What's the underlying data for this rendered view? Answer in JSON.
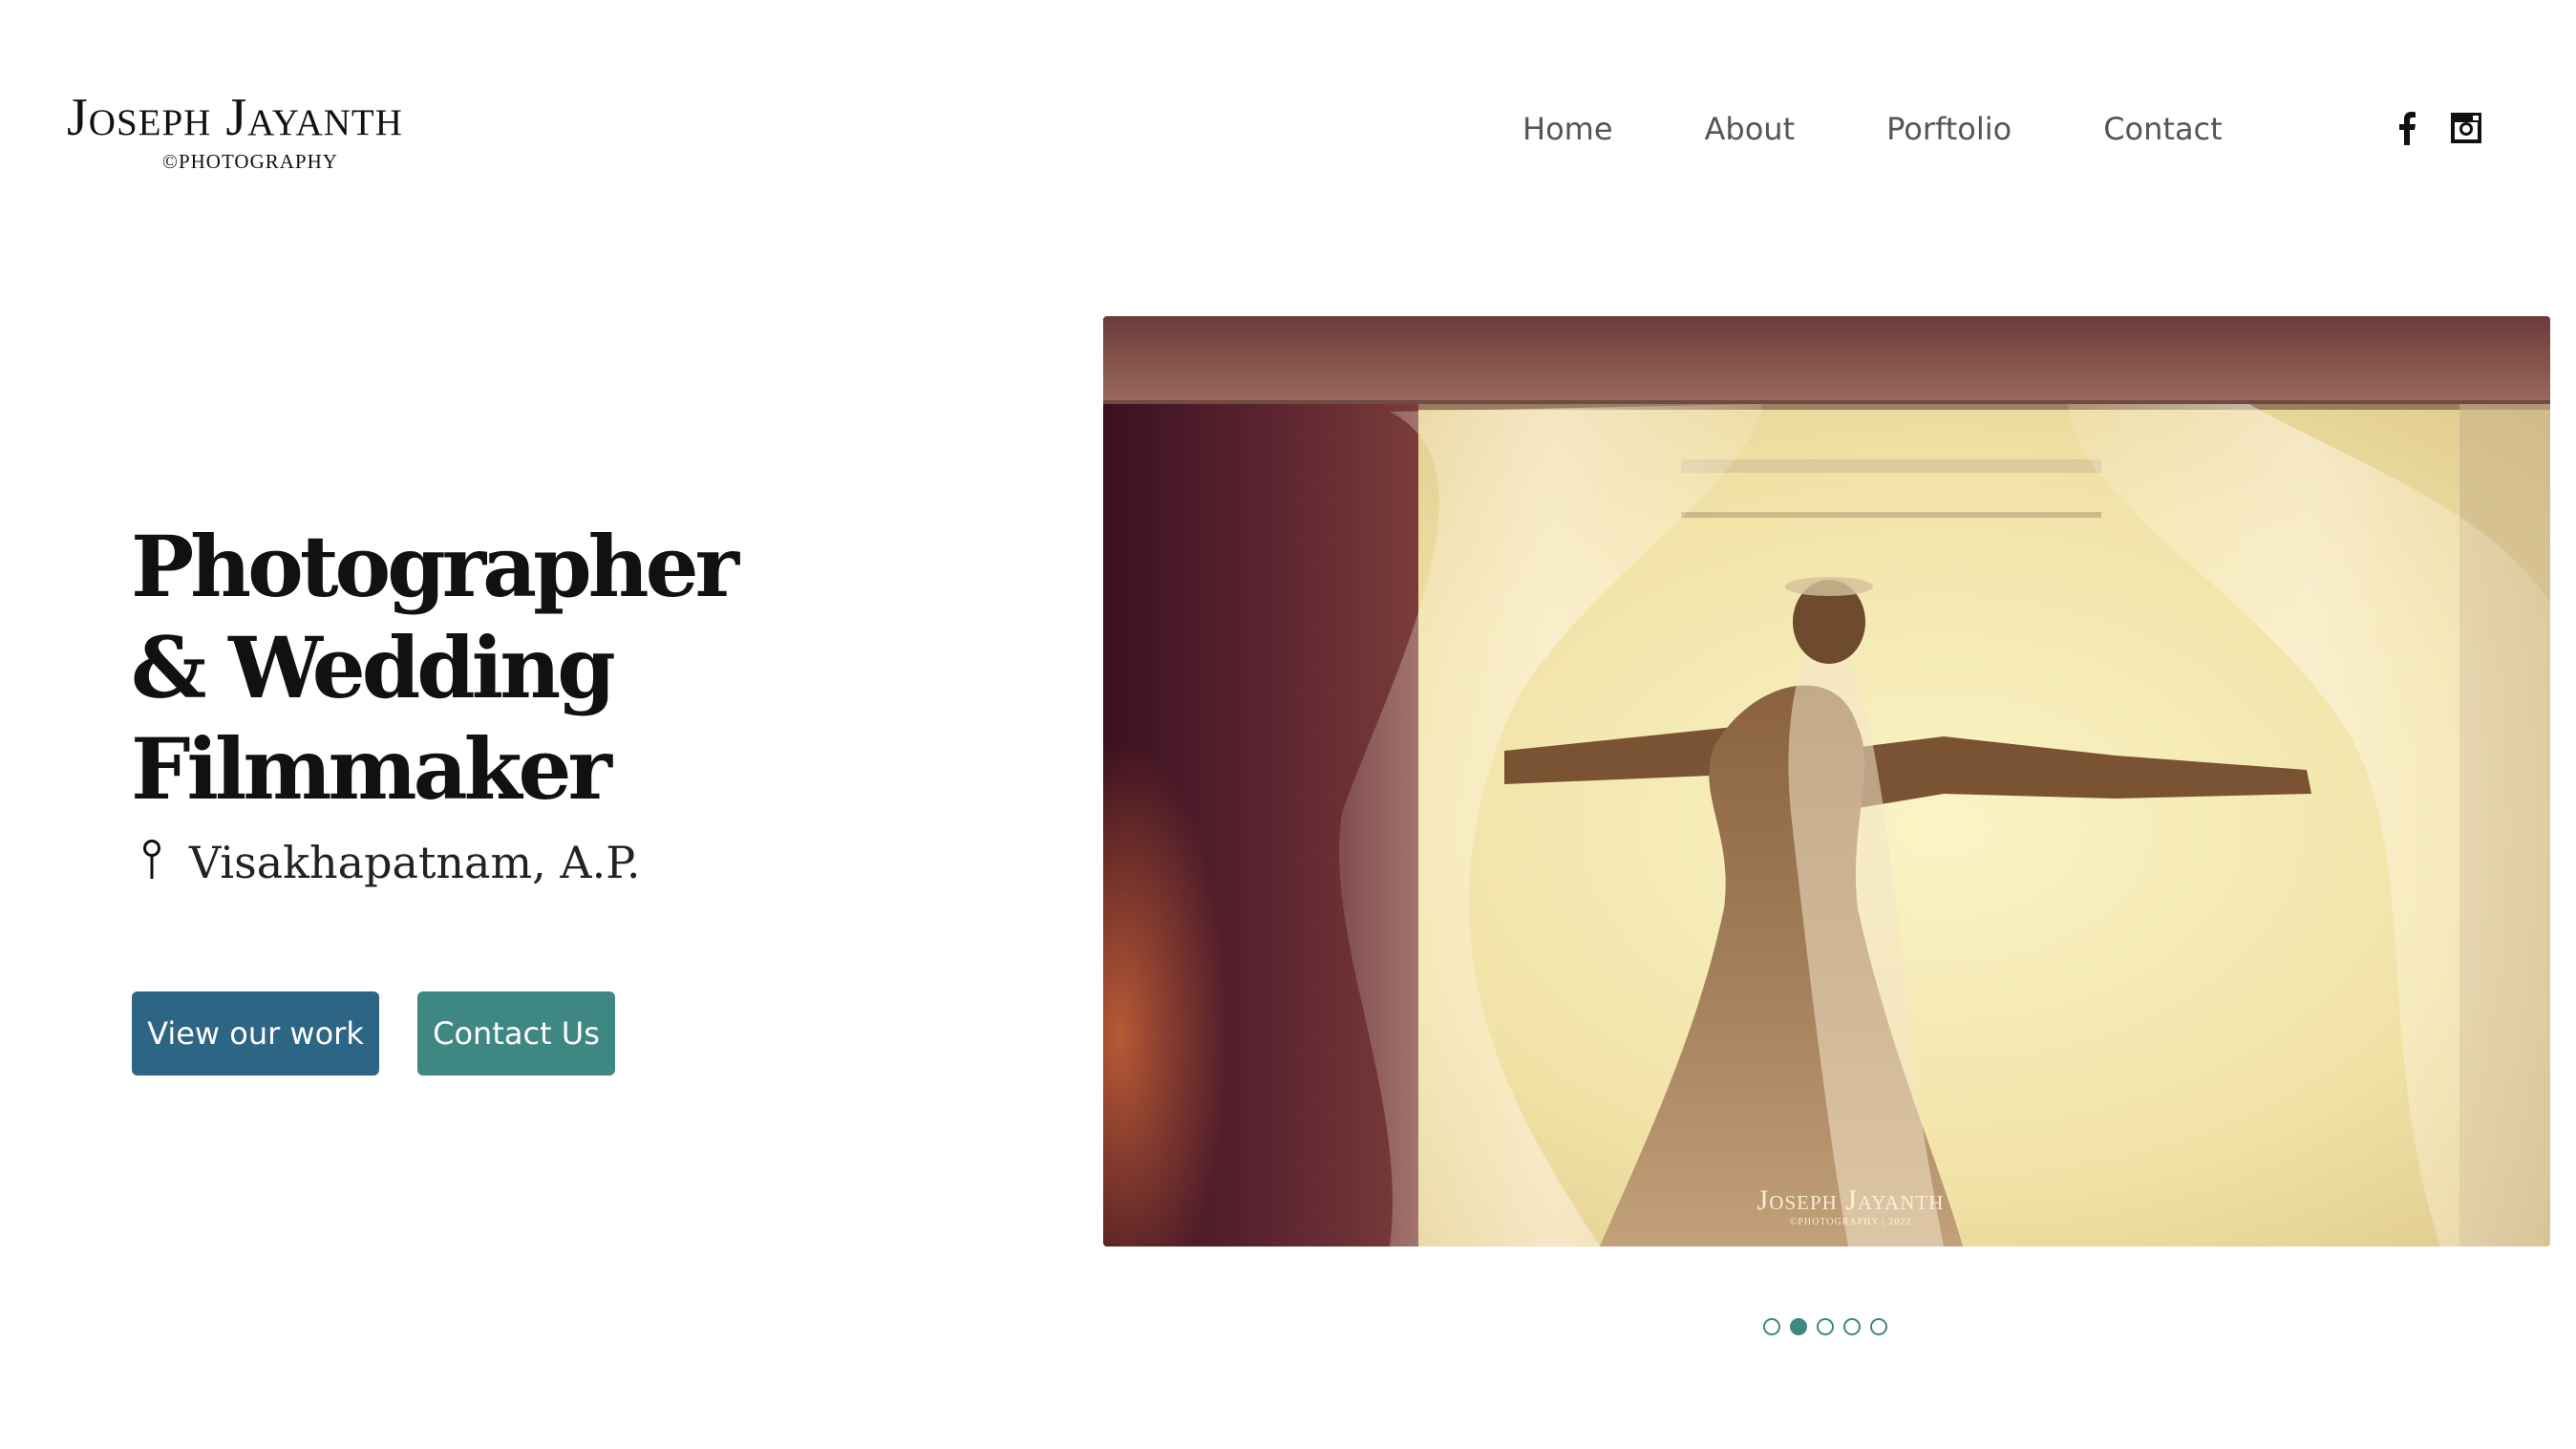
{
  "brand": {
    "name": "Joseph Jayanth",
    "tagline": "©PHOTOGRAPHY"
  },
  "nav": {
    "items": [
      {
        "label": "Home"
      },
      {
        "label": "About"
      },
      {
        "label": "Porftolio"
      },
      {
        "label": "Contact"
      }
    ]
  },
  "social": {
    "icons": [
      "facebook-icon",
      "instagram-icon"
    ]
  },
  "hero": {
    "title_line1": "Photographer",
    "title_line2": "& Wedding",
    "title_line3": "Filmmaker",
    "location": "Visakhapatnam, A.P.",
    "location_icon": "location-pin-icon",
    "primary_button": "View our work",
    "secondary_button": "Contact Us"
  },
  "slider": {
    "watermark_name": "Joseph Jayanth",
    "watermark_sub": "©PHOTOGRAPHY | 2022",
    "slide_count": 5,
    "active_slide": 2
  },
  "colors": {
    "primary_button": "#2d6584",
    "secondary_button": "#3f8782",
    "dot_accent": "#3f8782",
    "text_dark": "#111111",
    "nav_text": "#555555"
  }
}
